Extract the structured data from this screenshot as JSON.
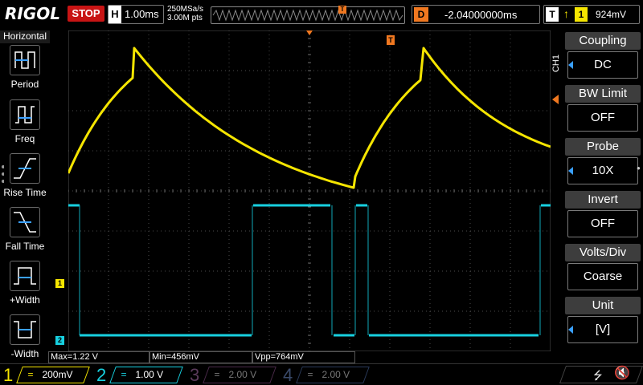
{
  "header": {
    "logo": "RIGOL",
    "run_state": "STOP",
    "timebase_letter": "H",
    "timebase": "1.00ms",
    "sample_rate": "250MSa/s",
    "memory_depth": "3.00M pts",
    "delay_letter": "D",
    "delay": "-2.04000000ms",
    "trigger_letter": "T",
    "trigger_source": "1",
    "trigger_level": "924mV",
    "trigger_marker": "T"
  },
  "left_panel": {
    "title": "Horizontal",
    "items": [
      {
        "label": "Period",
        "icon": "period-icon"
      },
      {
        "label": "Freq",
        "icon": "frequency-icon"
      },
      {
        "label": "Rise Time",
        "icon": "rise-time-icon"
      },
      {
        "label": "Fall Time",
        "icon": "fall-time-icon"
      },
      {
        "label": "+Width",
        "icon": "positive-width-icon"
      },
      {
        "label": "-Width",
        "icon": "negative-width-icon"
      }
    ]
  },
  "right_menu": {
    "channel_tag": "CH1",
    "items": [
      {
        "title": "Coupling",
        "value": "DC"
      },
      {
        "title": "BW Limit",
        "value": "OFF"
      },
      {
        "title": "Probe",
        "value": "10X"
      },
      {
        "title": "Invert",
        "value": "OFF"
      },
      {
        "title": "Volts/Div",
        "value": "Coarse"
      },
      {
        "title": "Unit",
        "value": "[V]"
      }
    ]
  },
  "measurements": {
    "max": "Max=1.22 V",
    "min": "Min=456mV",
    "vpp": "Vpp=764mV"
  },
  "markers": {
    "ch1_ground": "1",
    "ch2_ground": "2",
    "trigger_top": "T"
  },
  "channels": [
    {
      "num": "1",
      "coupling": "=",
      "scale": "200mV",
      "color": "#f5e500",
      "active": true
    },
    {
      "num": "2",
      "coupling": "=",
      "scale": "1.00 V",
      "color": "#17d0e0",
      "active": true
    },
    {
      "num": "3",
      "coupling": "=",
      "scale": "2.00 V",
      "color": "#c040c0",
      "active": false
    },
    {
      "num": "4",
      "coupling": "=",
      "scale": "2.00 V",
      "color": "#3060ff",
      "active": false
    }
  ],
  "colors": {
    "ch1": "#f5e500",
    "ch2": "#17d0e0",
    "trigger": "#f07820",
    "stop": "#c81414"
  }
}
